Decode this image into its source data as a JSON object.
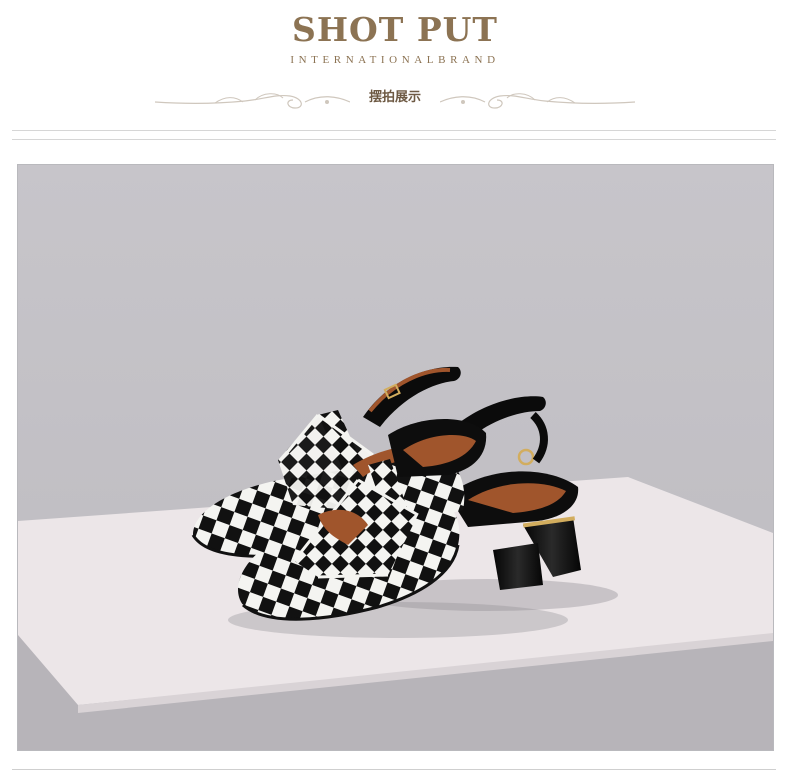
{
  "header": {
    "brand": "SHOT PUT",
    "tagline": "INTERNATIONALBRAND",
    "subtitle": "摆拍展示"
  },
  "photo": {
    "subject": "shoe-photo",
    "colors": {
      "background": "#c8c6cb",
      "platform_top": "#ece6e8",
      "platform_front": "#b7b4b9",
      "check_dark": "#111111",
      "check_light": "#f4f4f1",
      "lining": "#a0552c",
      "gold": "#d2ad5e"
    }
  }
}
